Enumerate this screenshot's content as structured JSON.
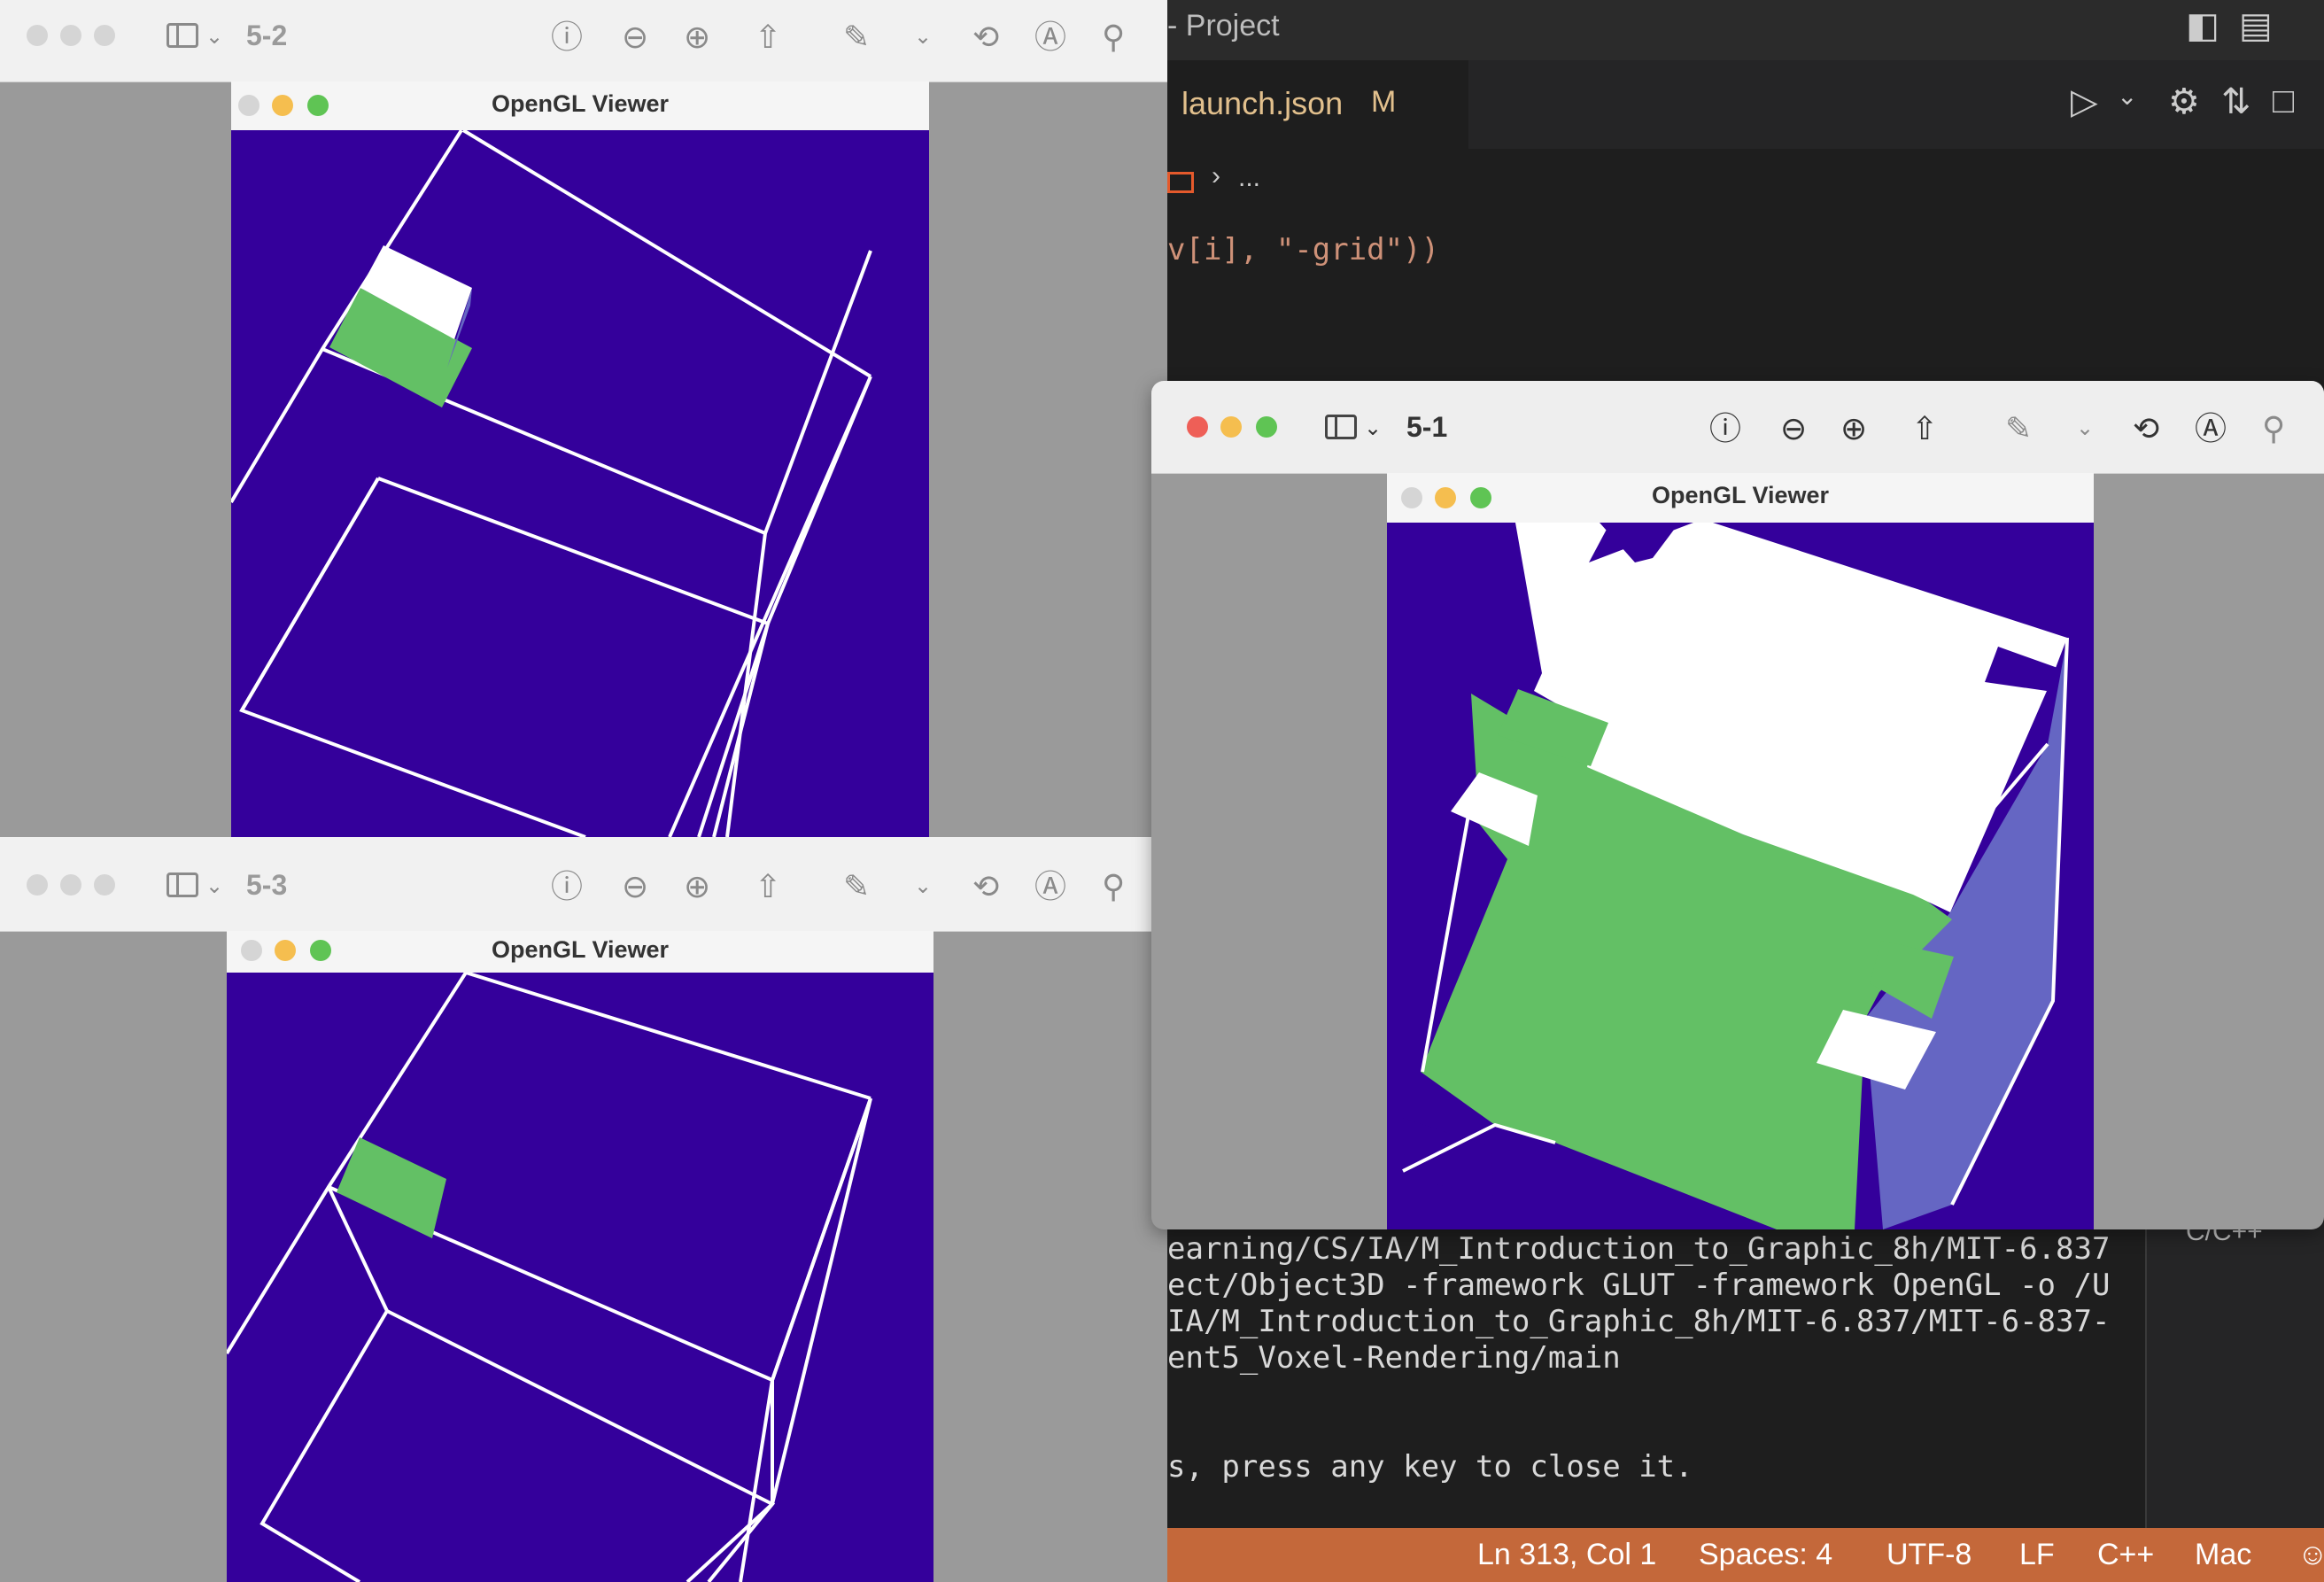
{
  "vscode": {
    "window_title": "- Project",
    "tab": {
      "label": "launch.json",
      "modified": "M"
    },
    "breadcrumb": "...",
    "code_line": "v[i], \"-grid\"))",
    "terminal_lines": [
      "earning/CS/IA/M_Introduction_to_Graphic_8h/MIT-6.837",
      "ect/Object3D -framework GLUT -framework OpenGL -o /U",
      "IA/M_Introduction_to_Graphic_8h/MIT-6.837/MIT-6-837-",
      "ent5_Voxel-Rendering/main",
      "",
      "",
      "s, press any key to close it."
    ],
    "right_panel_label": "C/C++",
    "status": {
      "position": "Ln 313, Col 1",
      "spaces": "Spaces: 4",
      "encoding": "UTF-8",
      "eol": "LF",
      "language": "C++",
      "platform": "Mac"
    },
    "colors": {
      "status_bar": "#c4683a",
      "tab_text": "#e2c08d"
    }
  },
  "preview_windows": [
    {
      "id": "5-2",
      "title": "5-2",
      "active": false,
      "gl_title": "OpenGL Viewer"
    },
    {
      "id": "5-3",
      "title": "5-3",
      "active": false,
      "gl_title": "OpenGL Viewer"
    },
    {
      "id": "5-1",
      "title": "5-1",
      "active": true,
      "gl_title": "OpenGL Viewer"
    }
  ],
  "icons": {
    "info": "info-icon",
    "zoom_out": "zoom-out-icon",
    "zoom_in": "zoom-in-icon",
    "share": "share-icon",
    "markup": "pencil-icon",
    "rotate": "rotate-icon",
    "annotate": "annotate-icon",
    "search": "search-icon"
  },
  "colors": {
    "gl_background": "#34009b",
    "voxel_green": "#63c065",
    "voxel_white": "#ffffff",
    "voxel_side": "#6566c3"
  }
}
